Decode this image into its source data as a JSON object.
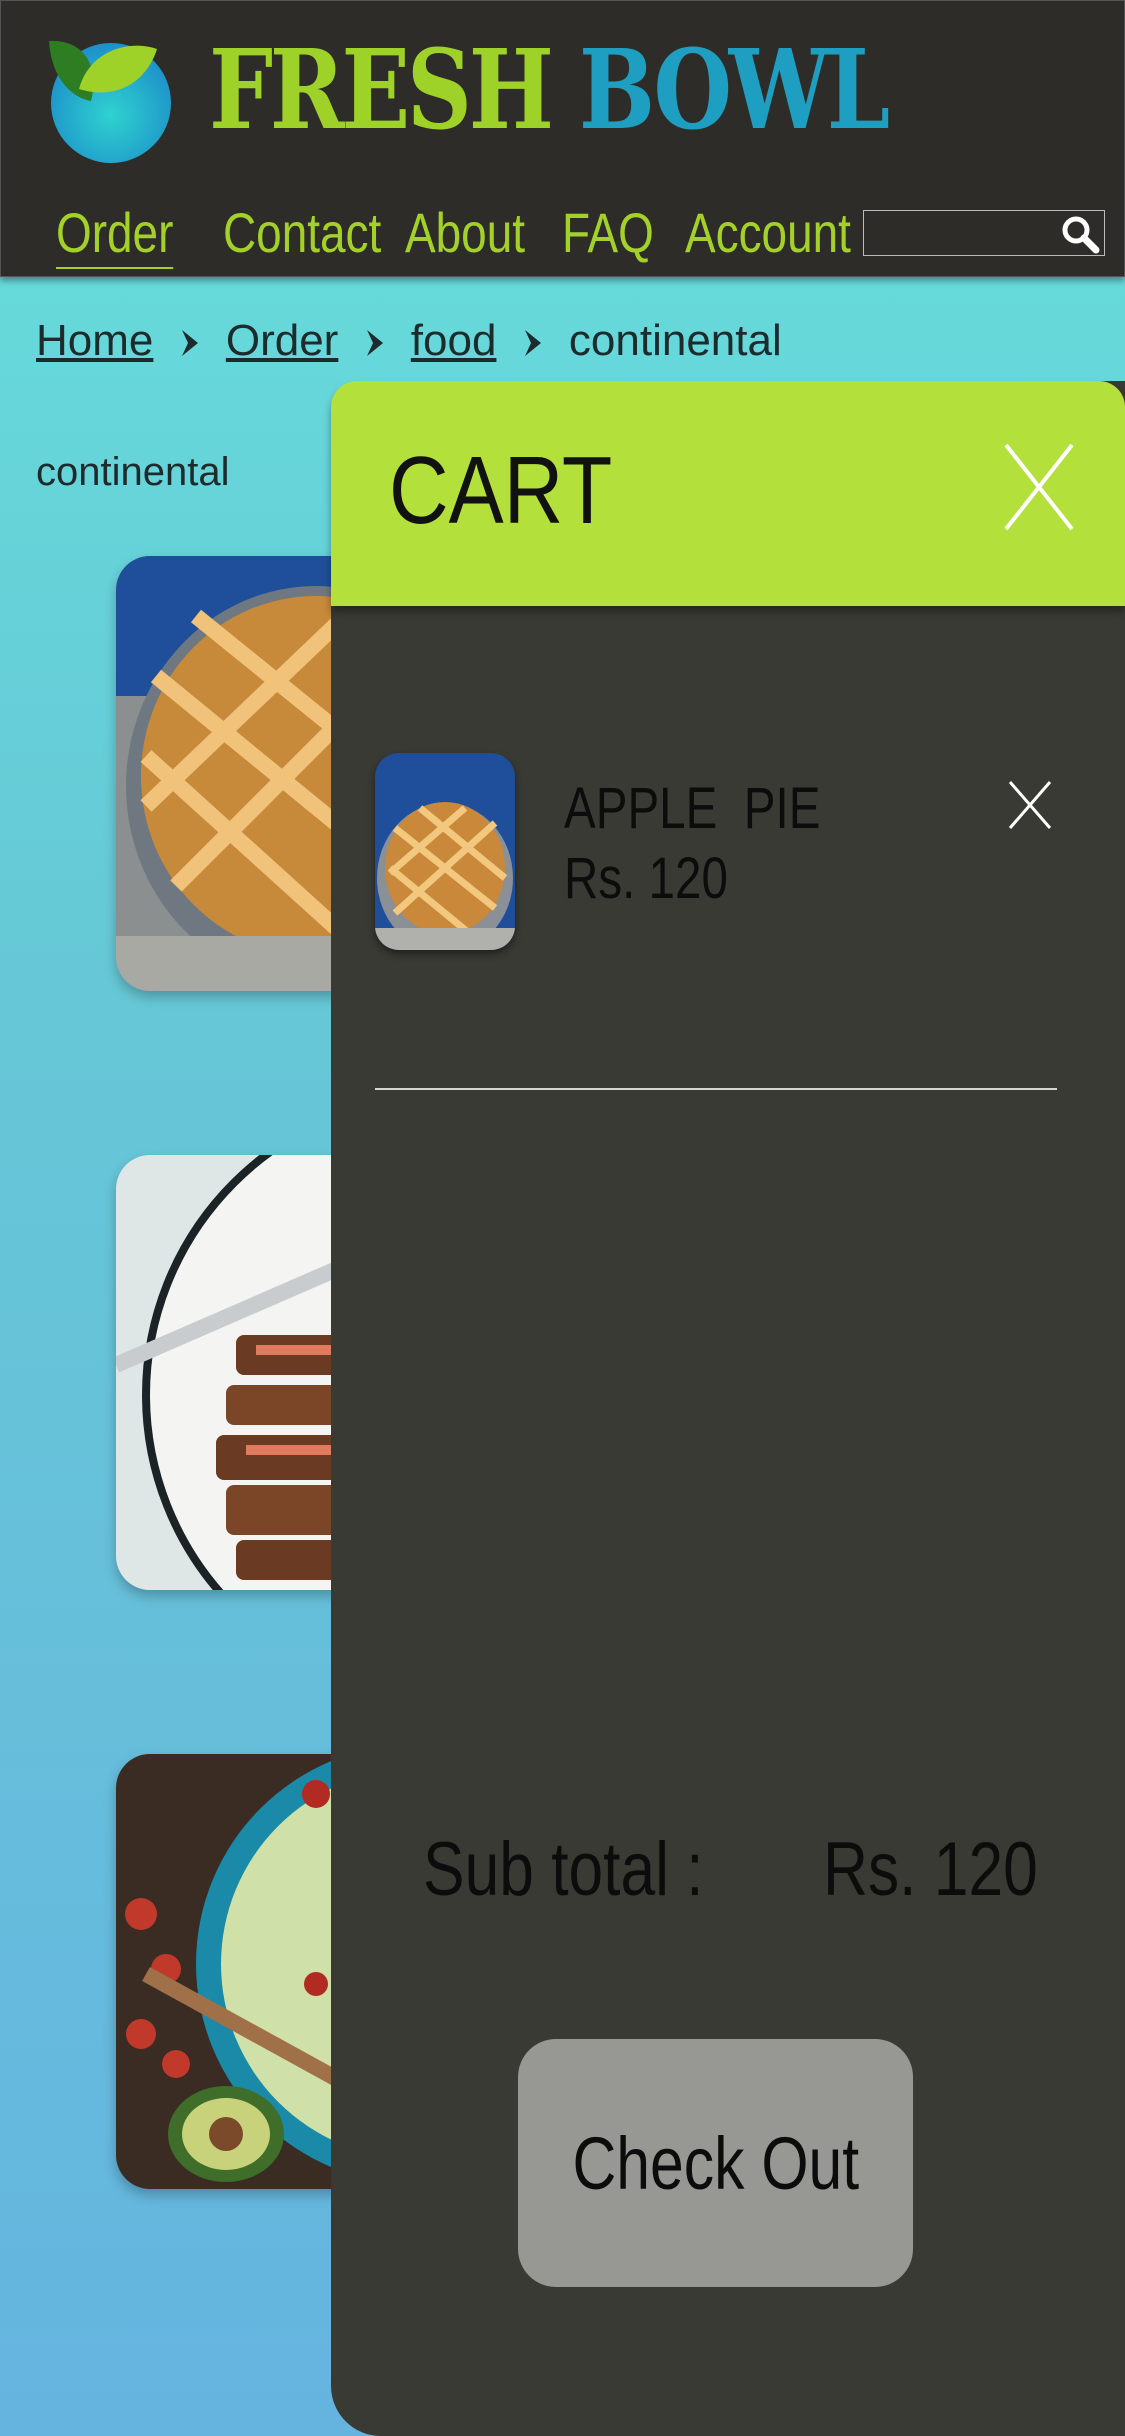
{
  "brand": {
    "word1": "FRESH",
    "word2": "BOWL",
    "logo_icon": "leaf-bowl-logo-icon"
  },
  "nav": [
    {
      "label": "Order",
      "active": true
    },
    {
      "label": "Contact",
      "active": false
    },
    {
      "label": "About",
      "active": false
    },
    {
      "label": "FAQ",
      "active": false
    },
    {
      "label": "Account",
      "active": false
    }
  ],
  "search": {
    "value": "",
    "placeholder": "",
    "icon": "search-icon"
  },
  "breadcrumb": {
    "home": "Home",
    "order": "Order",
    "food": "food",
    "current": "continental"
  },
  "category_title": "continental",
  "food_cards": [
    {
      "name": "apple-pie-photo"
    },
    {
      "name": "steak-photo"
    },
    {
      "name": "salad-photo"
    }
  ],
  "cart": {
    "title": "CART",
    "items": [
      {
        "name": "APPLE  PIE",
        "price": "Rs. 120"
      }
    ],
    "subtotal_label": "Sub total :",
    "subtotal_value": "Rs. 120",
    "checkout_label": "Check Out"
  },
  "colors": {
    "header_bg": "#2d2c28",
    "accent_green": "#a3d12a",
    "accent_blue": "#1e9fc1",
    "cart_bg": "#393a34",
    "cart_header": "#b3e03a"
  }
}
